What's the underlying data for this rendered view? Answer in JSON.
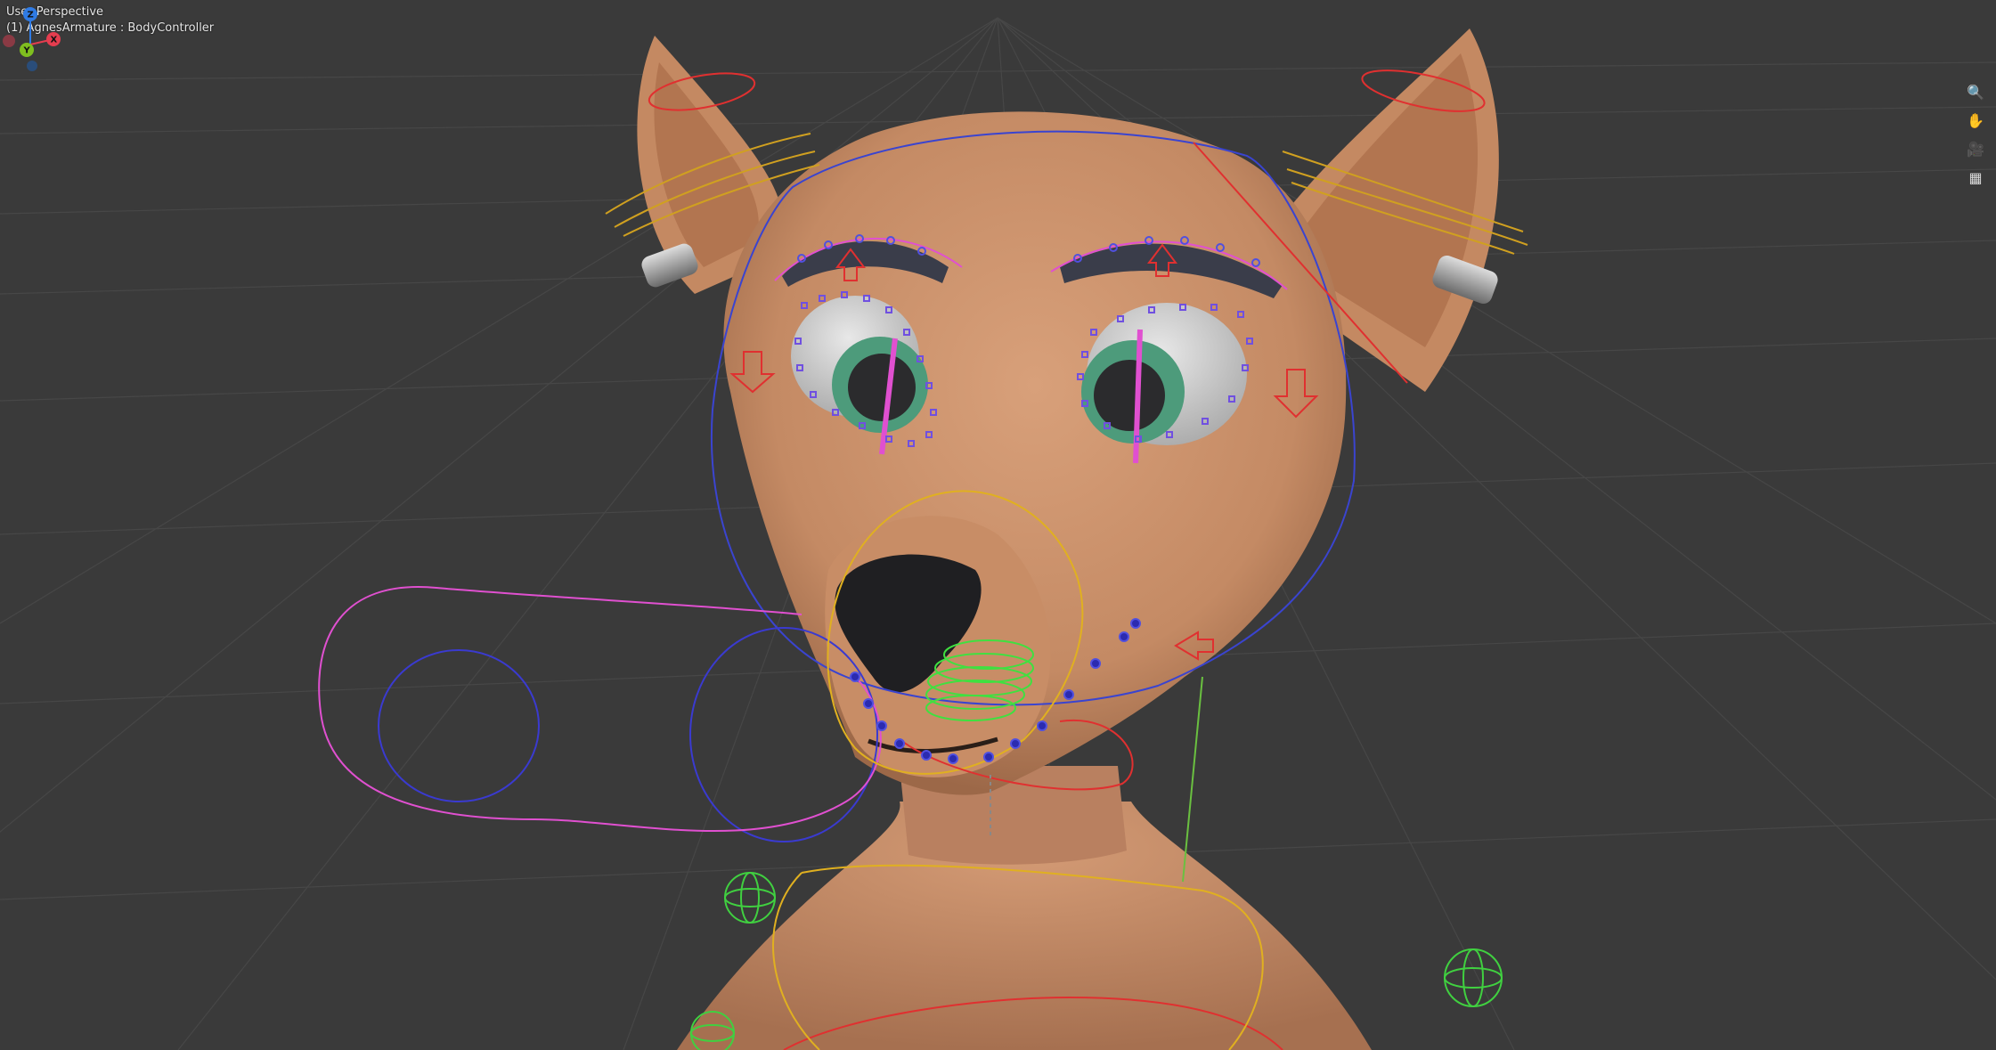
{
  "viewport": {
    "view_name": "User Perspective",
    "object_info": "(1) AgnesArmature : BodyController"
  },
  "gizmo": {
    "axes": [
      {
        "label": "Z",
        "color": "#2f7be5"
      },
      {
        "label": "Y",
        "color": "#7fbf1f"
      },
      {
        "label": "X",
        "color": "#e53d4f"
      }
    ]
  },
  "nav_tools": [
    {
      "name": "zoom",
      "icon": "magnifier-icon"
    },
    {
      "name": "pan",
      "icon": "hand-icon"
    },
    {
      "name": "camera",
      "icon": "camera-icon"
    },
    {
      "name": "grid",
      "icon": "grid-icon"
    }
  ],
  "colors": {
    "background": "#3a3a3a",
    "grid": "#4a4a4a",
    "skin": "#c98f6a",
    "bone_pink": "#e14fd2",
    "bone_blue": "#3a3ad0",
    "bone_yellow": "#e0b020",
    "bone_red": "#e03030",
    "bone_green": "#38d038"
  }
}
